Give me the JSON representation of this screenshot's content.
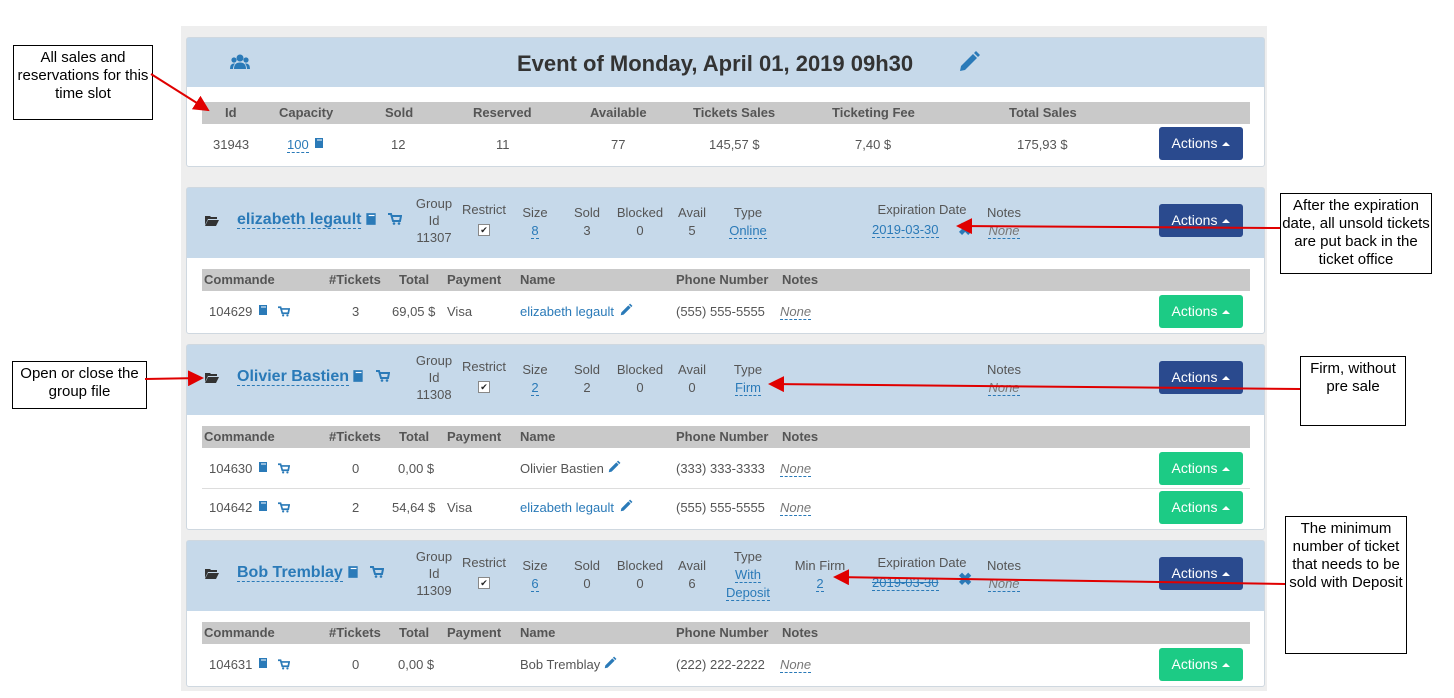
{
  "event": {
    "title": "Event of Monday, April 01, 2019 09h30",
    "headers": [
      "Id",
      "Capacity",
      "Sold",
      "Reserved",
      "Available",
      "Tickets Sales",
      "Ticketing Fee",
      "Total Sales"
    ],
    "row": {
      "id": "31943",
      "capacity": "100",
      "sold": "12",
      "reserved": "11",
      "available": "77",
      "tickets_sales": "145,57 $",
      "fee": "7,40 $",
      "total": "175,93 $"
    },
    "actions_label": "Actions"
  },
  "group_labels": {
    "group_id": "Group",
    "id": "Id",
    "restrict": "Restrict",
    "size": "Size",
    "sold": "Sold",
    "blocked": "Blocked",
    "avail": "Avail",
    "type": "Type",
    "min_firm": "Min Firm",
    "expiration": "Expiration Date",
    "notes": "Notes"
  },
  "order_headers": [
    "Commande",
    "#Tickets",
    "Total",
    "Payment",
    "Name",
    "Phone Number",
    "Notes"
  ],
  "groups": [
    {
      "name": "elizabeth legault",
      "group_id": "11307",
      "size": "8",
      "sold": "3",
      "blocked": "0",
      "avail": "5",
      "type": "Online",
      "expiration": "2019-03-30",
      "notes": "None",
      "actions": "Actions",
      "orders": [
        {
          "num": "104629",
          "tickets": "3",
          "total": "69,05 $",
          "payment": "Visa",
          "name": "elizabeth legault",
          "phone": "(555) 555-5555",
          "notes": "None",
          "actions": "Actions"
        }
      ]
    },
    {
      "name": "Olivier Bastien",
      "group_id": "11308",
      "size": "2",
      "sold": "2",
      "blocked": "0",
      "avail": "0",
      "type": "Firm",
      "notes": "None",
      "actions": "Actions",
      "orders": [
        {
          "num": "104630",
          "tickets": "0",
          "total": "0,00 $",
          "payment": "",
          "name": "Olivier Bastien",
          "phone": "(333) 333-3333",
          "notes": "None",
          "actions": "Actions"
        },
        {
          "num": "104642",
          "tickets": "2",
          "total": "54,64 $",
          "payment": "Visa",
          "name": "elizabeth legault",
          "phone": "(555) 555-5555",
          "notes": "None",
          "actions": "Actions"
        }
      ]
    },
    {
      "name": "Bob Tremblay",
      "group_id": "11309",
      "size": "6",
      "sold": "0",
      "blocked": "0",
      "avail": "6",
      "type_line1": "With",
      "type_line2": "Deposit",
      "min_firm": "2",
      "expiration": "2019-03-30",
      "notes": "None",
      "actions": "Actions",
      "orders": [
        {
          "num": "104631",
          "tickets": "0",
          "total": "0,00 $",
          "payment": "",
          "name": "Bob Tremblay",
          "phone": "(222) 222-2222",
          "notes": "None",
          "actions": "Actions"
        }
      ]
    }
  ],
  "callouts": {
    "all_sales": "All sales and reservations for this time slot",
    "open_close": "Open or close the group file",
    "expiration": "After the expiration date, all unsold tickets are put back in the ticket office",
    "firm": "Firm, without pre sale",
    "min_firm": "The minimum number of ticket that needs to be sold with Deposit"
  },
  "colors": {
    "header_bg": "#c6d9ea",
    "btn_blue": "#2a4a8e",
    "btn_green": "#1ccb85",
    "link": "#2a7ab8",
    "arrow": "#e00000"
  },
  "icons": [
    "users-icon",
    "pencil-icon",
    "book-icon",
    "cart-icon",
    "folder-open-icon",
    "close-x-icon",
    "caret-up-icon"
  ]
}
